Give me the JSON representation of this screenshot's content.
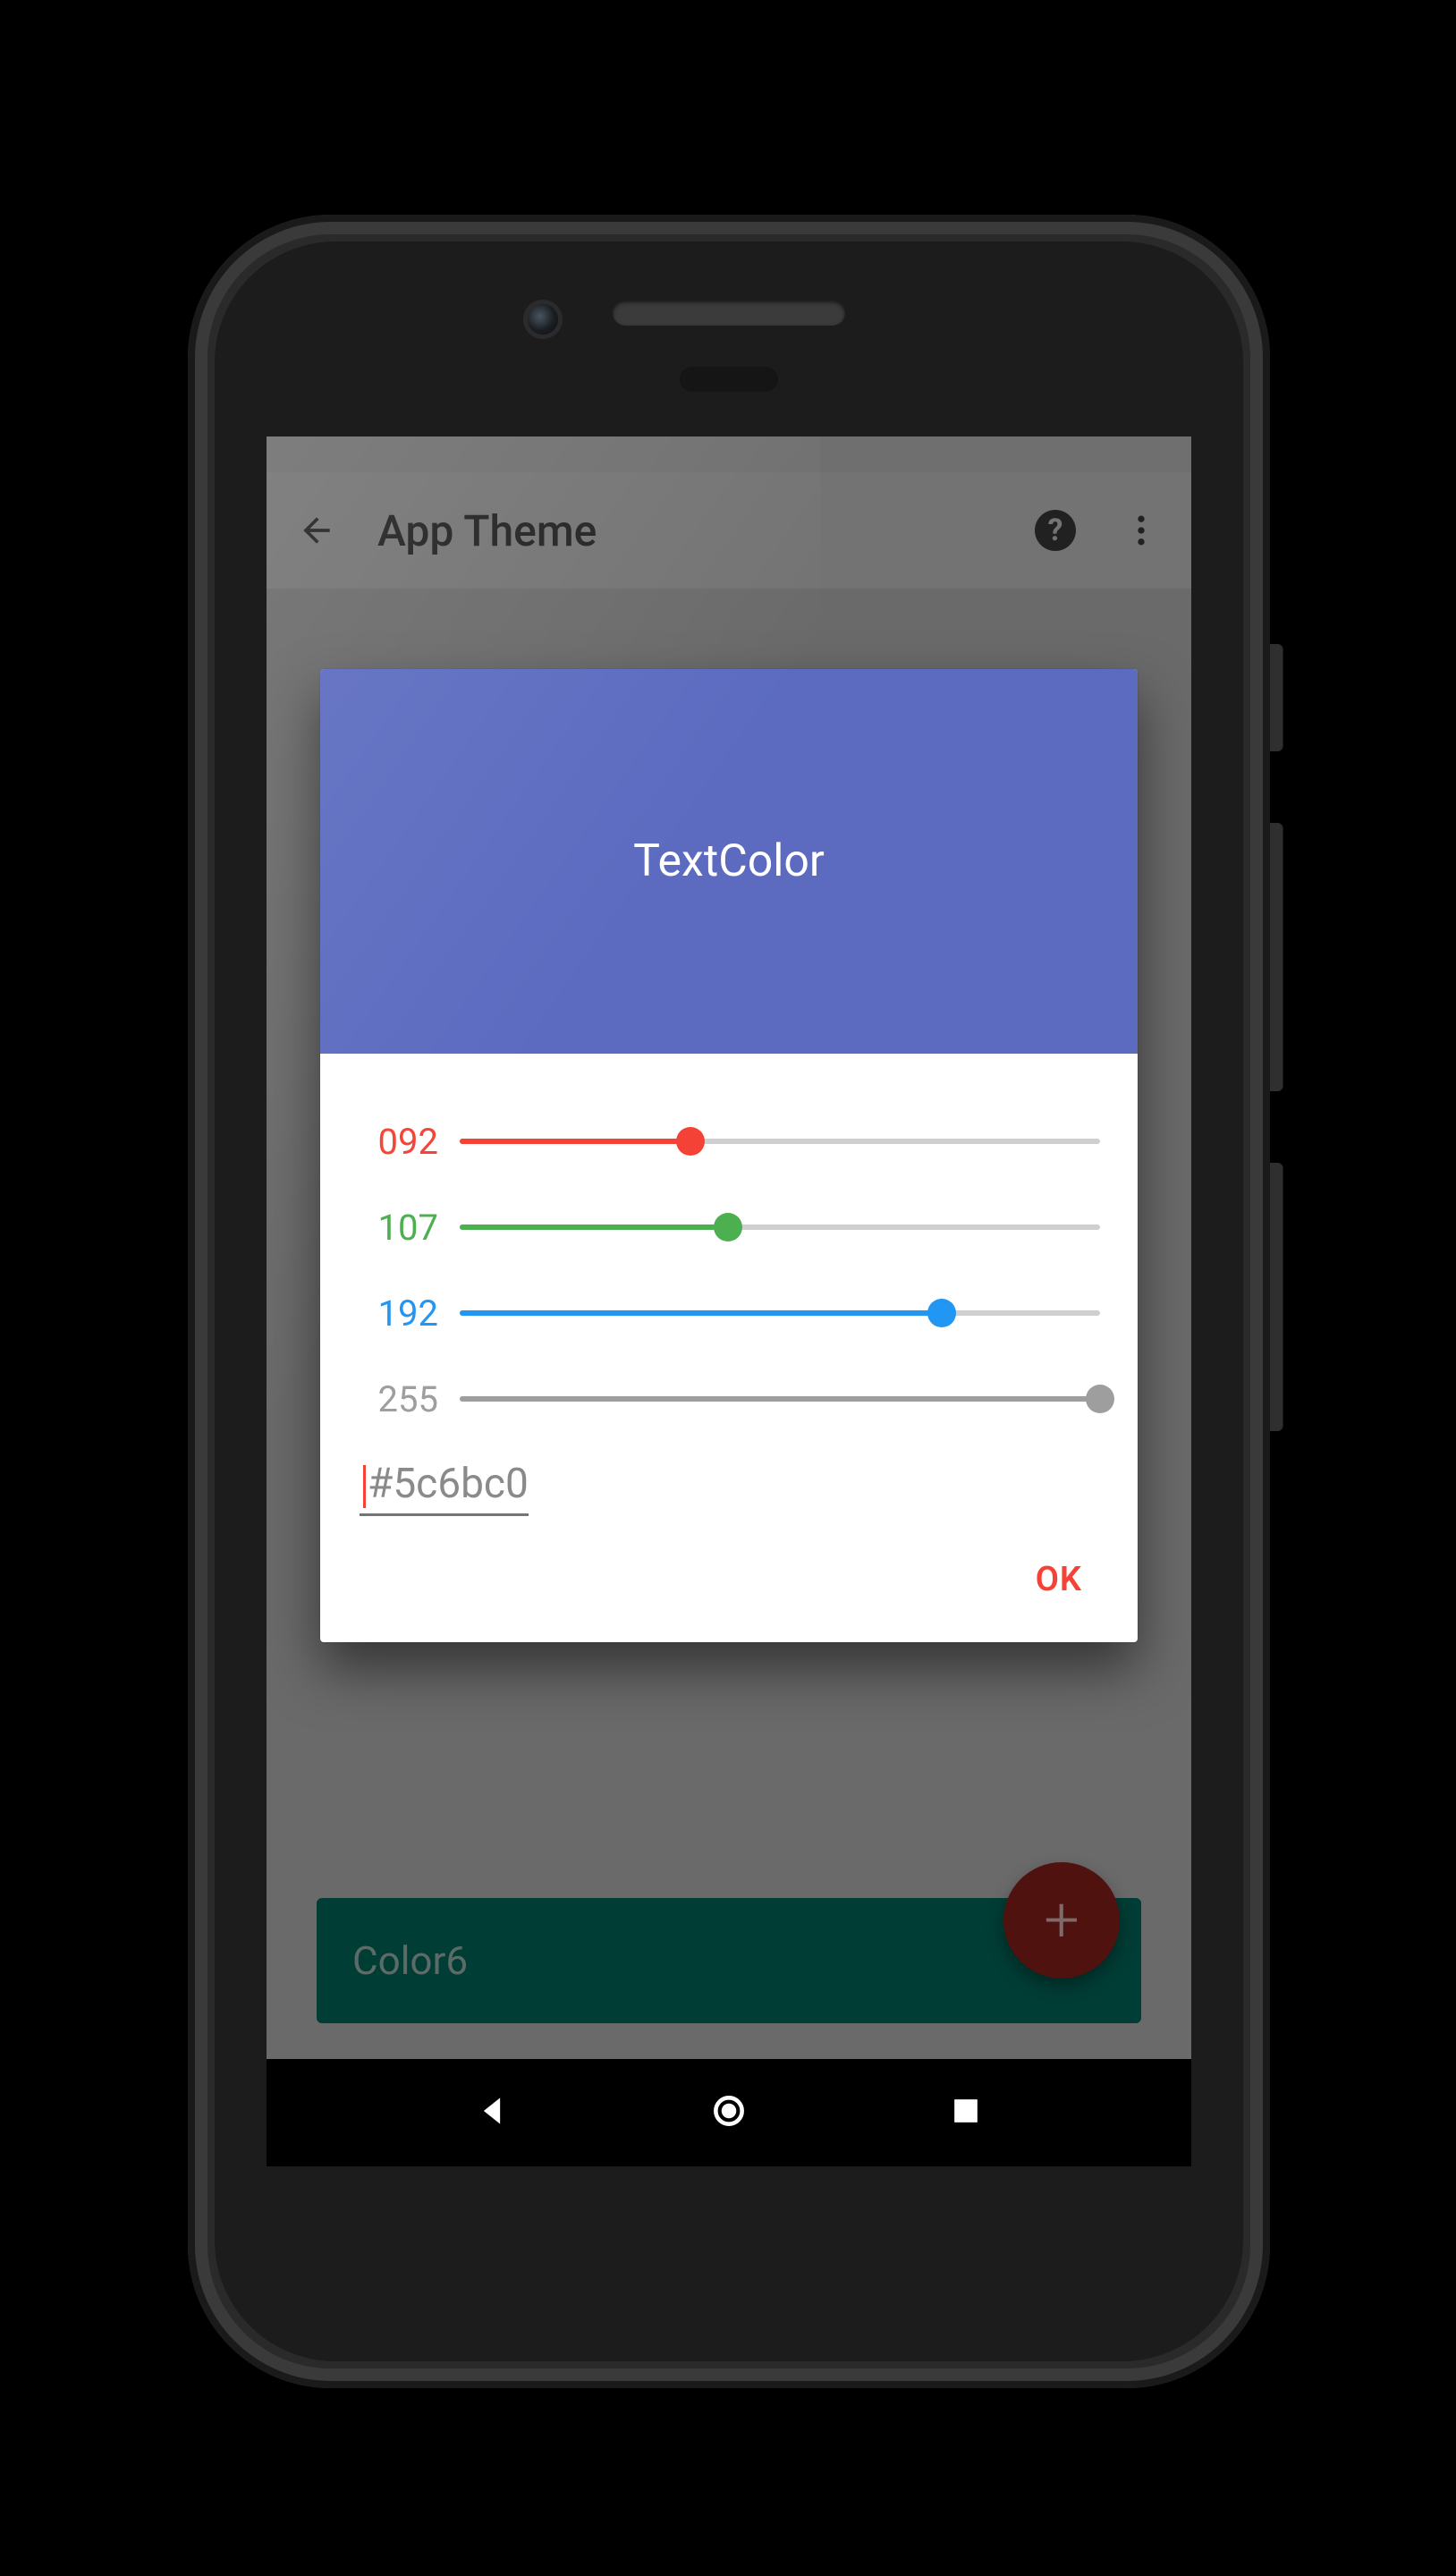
{
  "toolbar": {
    "title": "App Theme"
  },
  "dialog": {
    "title": "TextColor",
    "sliders": {
      "r": {
        "label": "092",
        "value": 92,
        "max": 255
      },
      "g": {
        "label": "107",
        "value": 107,
        "max": 255
      },
      "b": {
        "label": "192",
        "value": 192,
        "max": 255
      },
      "a": {
        "label": "255",
        "value": 255,
        "max": 255
      }
    },
    "hex": "#5c6bc0",
    "header_color": "#5c6bc0",
    "ok": "OK"
  },
  "bgcard": {
    "label": "Color6"
  },
  "fab": {
    "glyph": "+"
  }
}
